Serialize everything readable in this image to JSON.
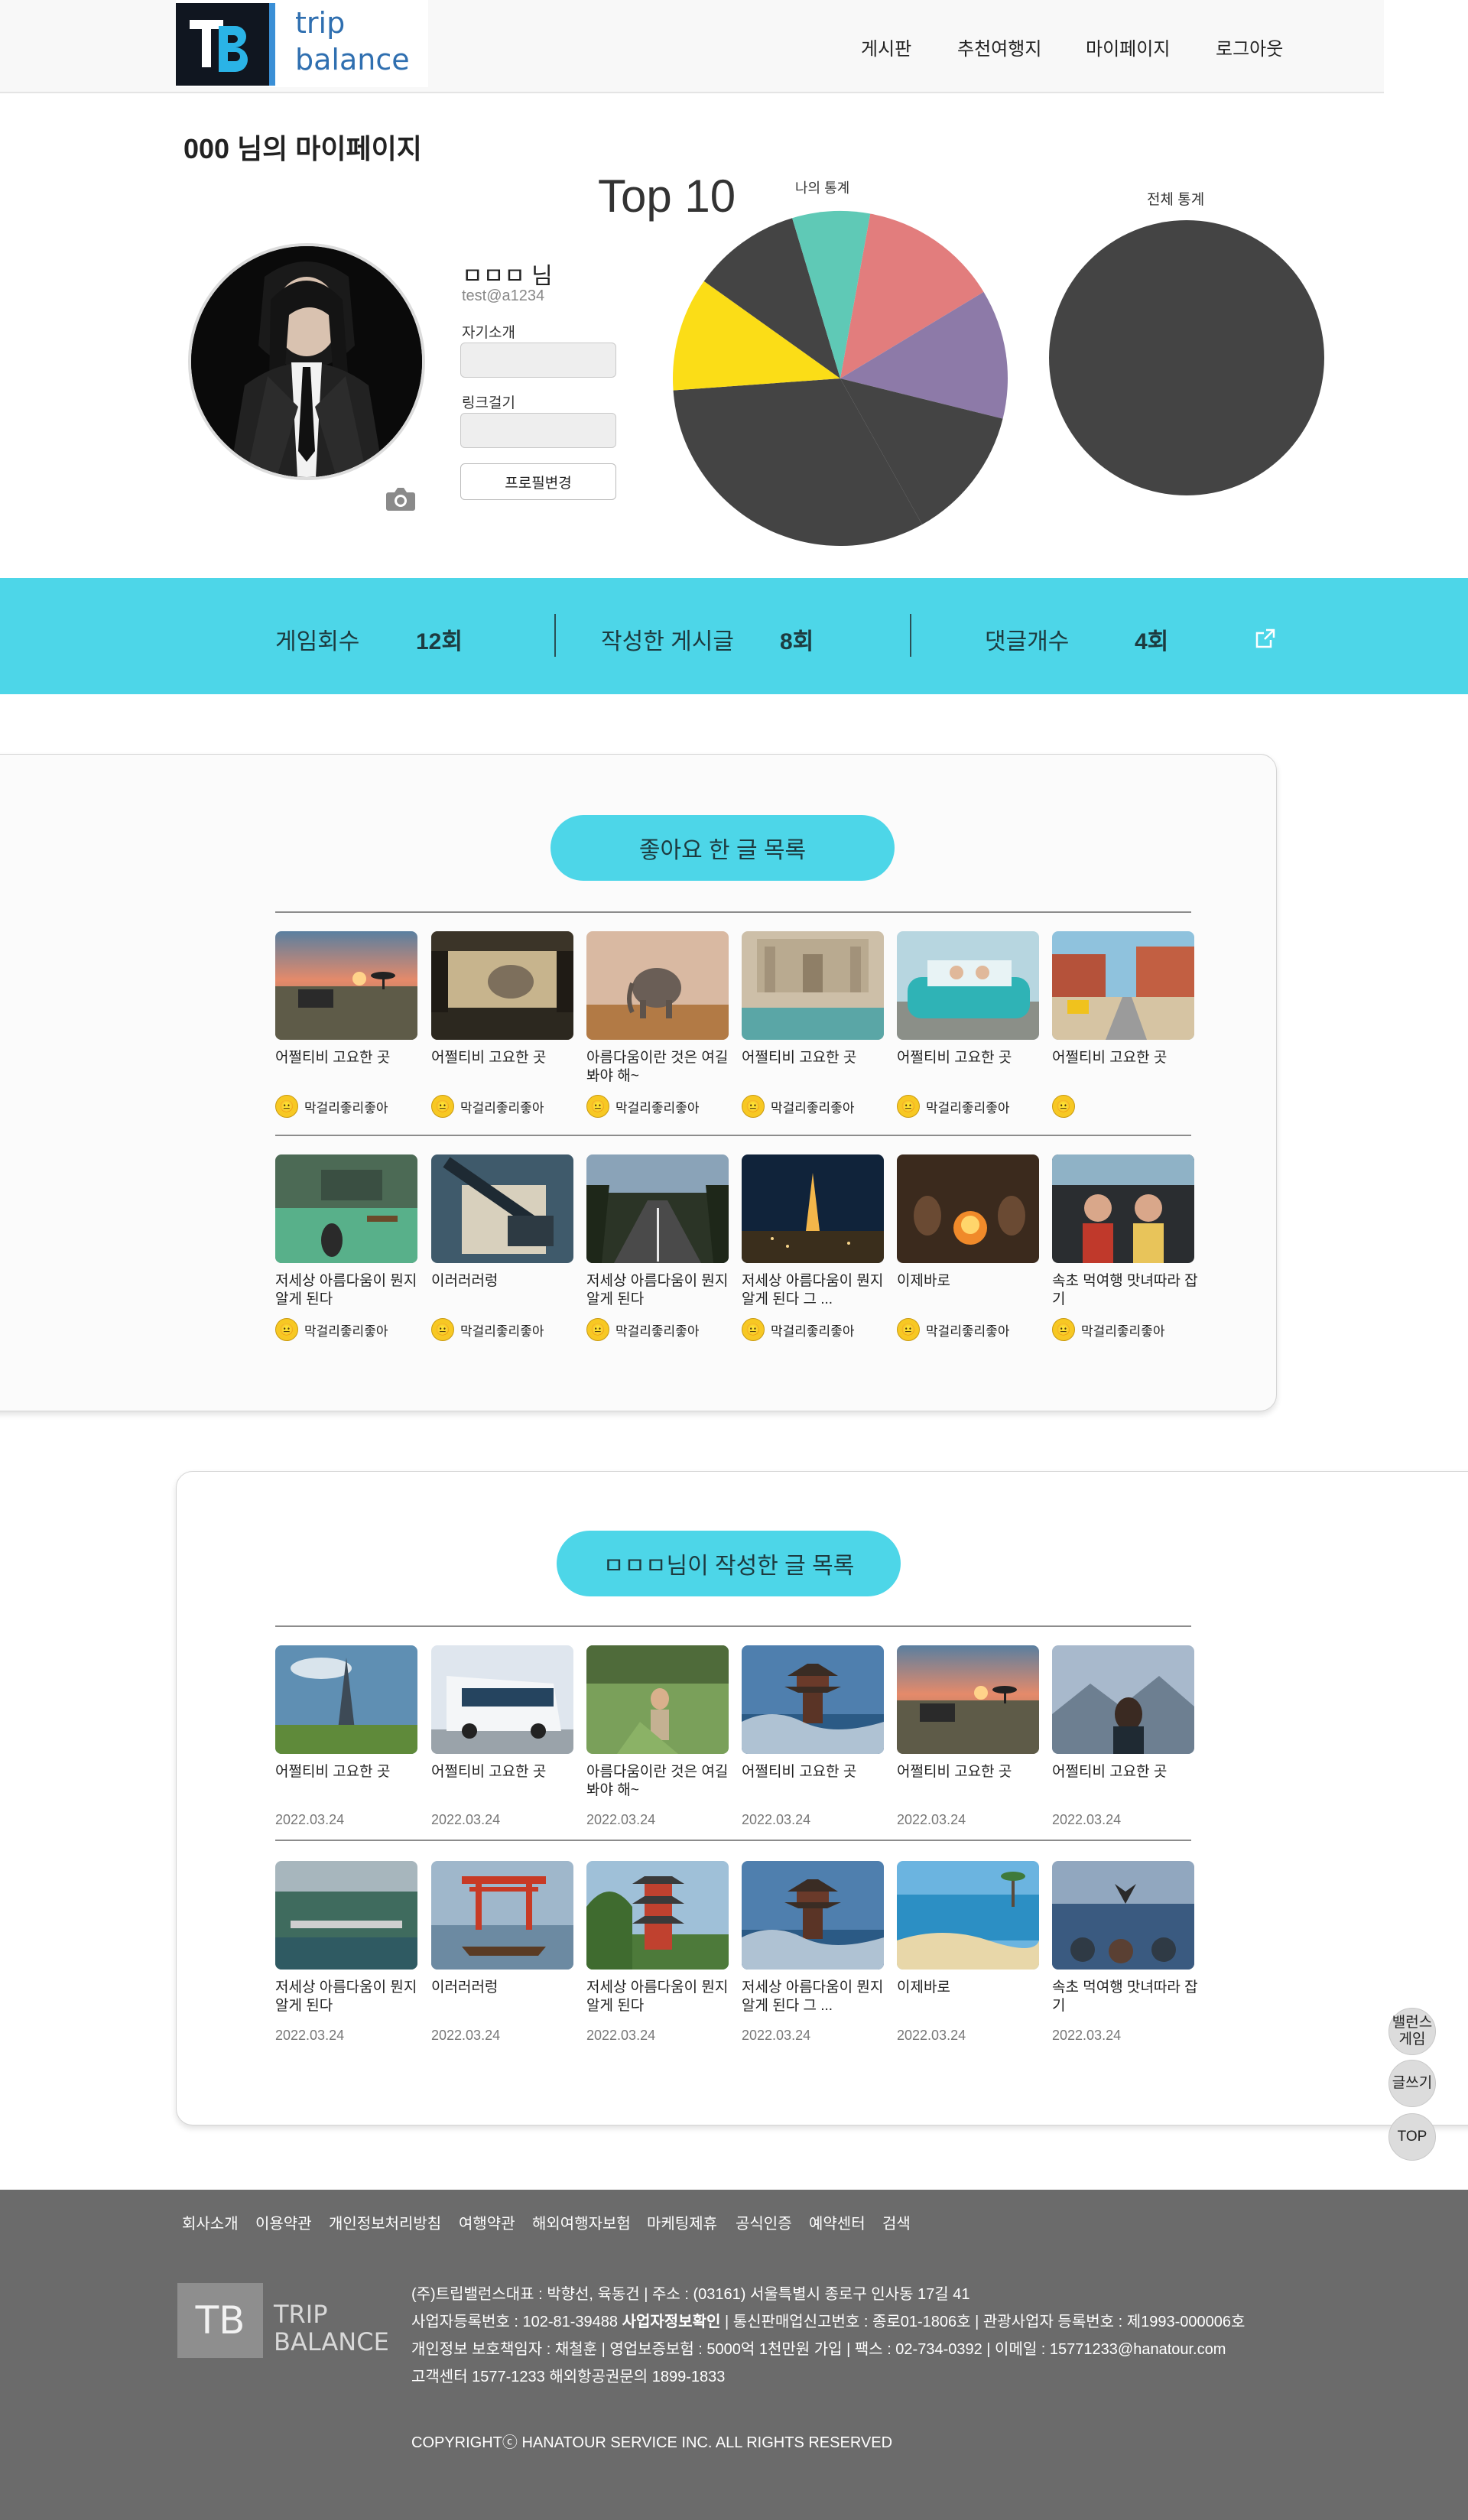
{
  "header": {
    "logo_mark": "TB",
    "logo_line1": "trip",
    "logo_line2": "balance",
    "nav": [
      "게시판",
      "추천여행지",
      "마이페이지",
      "로그아웃"
    ]
  },
  "profile": {
    "page_title": "000 님의 마이페이지",
    "name": "ㅁㅁㅁ 님",
    "email": "test@a1234",
    "intro_label": "자기소개",
    "link_label": "링크걸기",
    "edit_button": "프로필변경"
  },
  "stats_charts": {
    "top_label": "Top 10",
    "my_label": "나의 통계",
    "all_label": "전체 통계"
  },
  "chart_data": [
    {
      "type": "pie",
      "title": "나의 통계",
      "values": [
        13.5,
        12.5,
        13,
        32,
        11,
        10.5,
        7.5
      ],
      "colors": [
        "#e27d7d",
        "#8d7aa8",
        "#444444",
        "#444444",
        "#fbdd17",
        "#444444",
        "#5fc9b6"
      ]
    },
    {
      "type": "pie",
      "title": "전체 통계",
      "values": [
        100
      ],
      "colors": [
        "#444444"
      ]
    }
  ],
  "activity": [
    {
      "label": "게임회수",
      "value": "12회"
    },
    {
      "label": "작성한 게시글",
      "value": "8회"
    },
    {
      "label": "댓글개수",
      "value": "4회"
    }
  ],
  "liked": {
    "heading": "좋아요 한 글 목록",
    "rows": [
      [
        {
          "title": "어쩔티비 고요한 곳",
          "reaction": "막걸리좋리좋아",
          "image": "savanna-sunset"
        },
        {
          "title": "어쩔티비 고요한 곳",
          "reaction": "막걸리좋리좋아",
          "image": "safari-truck"
        },
        {
          "title": "아름다움이란 것은 여길봐야 해~",
          "reaction": "막걸리좋리좋아",
          "image": "elephant"
        },
        {
          "title": "어쩔티비 고요한 곳",
          "reaction": "막걸리좋리좋아",
          "image": "trevi-fountain"
        },
        {
          "title": "어쩔티비 고요한 곳",
          "reaction": "막걸리좋리좋아",
          "image": "vintage-car"
        },
        {
          "title": "어쩔티비 고요한 곳",
          "reaction": "",
          "image": "desert-road"
        }
      ],
      [
        {
          "title": "저세상 아름다움이 뭔지 알게 된다",
          "reaction": "막걸리좋리좋아",
          "image": "lake-boats"
        },
        {
          "title": "이러러러렁",
          "reaction": "막걸리좋리좋아",
          "image": "map-writing"
        },
        {
          "title": "저세상 아름다움이 뭔지 알게 된다",
          "reaction": "막걸리좋리좋아",
          "image": "forest-road"
        },
        {
          "title": "저세상 아름다움이 뭔지 알게 된다 그 ...",
          "reaction": "막걸리좋리좋아",
          "image": "eiffel-night"
        },
        {
          "title": "이제바로",
          "reaction": "막걸리좋리좋아",
          "image": "campfire"
        },
        {
          "title": "속초 먹여행 맛녀따라 잡기",
          "reaction": "막걸리좋리좋아",
          "image": "car-friends"
        }
      ]
    ]
  },
  "written": {
    "heading": "ㅁㅁㅁ님이 작성한 글 목록",
    "rows": [
      [
        {
          "title": "어쩔티비 고요한 곳",
          "date": "2022.03.24",
          "image": "eiffel-day"
        },
        {
          "title": "어쩔티비 고요한 곳",
          "date": "2022.03.24",
          "image": "tour-bus"
        },
        {
          "title": "아름다움이란 것은 여길봐야 해~",
          "date": "2022.03.24",
          "image": "meadow-hiker"
        },
        {
          "title": "어쩔티비 고요한 곳",
          "date": "2022.03.24",
          "image": "pagoda-sea"
        },
        {
          "title": "어쩔티비 고요한 곳",
          "date": "2022.03.24",
          "image": "savanna-sunset"
        },
        {
          "title": "어쩔티비 고요한 곳",
          "date": "2022.03.24",
          "image": "mountain-view"
        }
      ],
      [
        {
          "title": "저세상 아름다움이 뭔지 알게 된다",
          "date": "2022.03.24",
          "image": "dam-lake"
        },
        {
          "title": "이러러러렁",
          "date": "2022.03.24",
          "image": "torii-boat"
        },
        {
          "title": "저세상 아름다움이 뭔지 알게 된다",
          "date": "2022.03.24",
          "image": "red-pagoda"
        },
        {
          "title": "저세상 아름다움이 뭔지 알게 된다 그 ...",
          "date": "2022.03.24",
          "image": "pagoda-sea"
        },
        {
          "title": "이제바로",
          "date": "2022.03.24",
          "image": "beach-cove"
        },
        {
          "title": "속초 먹여행 맛녀따라 잡기",
          "date": "2022.03.24",
          "image": "whale-watch"
        }
      ]
    ]
  },
  "floating": {
    "balance_game": "밸런스 게임",
    "write": "글쓰기",
    "top": "TOP"
  },
  "footer": {
    "links": [
      "회사소개",
      "이용약관",
      "개인정보처리방침",
      "여행약관",
      "해외여행자보험",
      "마케팅제휴",
      "공식인증",
      "예약센터",
      "검색"
    ],
    "logo_mark": "TB",
    "logo_line1": "TRIP",
    "logo_line2": "BALANCE",
    "line1": "(주)트립밸런스대표 : 박향선, 육동건 | 주소 : (03161) 서울특별시 종로구 인사동 17길 41",
    "line2_a": "사업자등록번호 : 102-81-39488 ",
    "line2_b": "사업자정보확인",
    "line2_c": " | 통신판매업신고번호 : 종로01-1806호 | 관광사업자 등록번호 : 제1993-000006호",
    "line3": "개인정보 보호책임자 : 채철훈 | 영업보증보험 : 5000억 1천만원 가입 | 팩스 : 02-734-0392 | 이메일 : 15771233@hanatour.com",
    "line4": "고객센터 1577-1233     해외항공권문의 1899-1833",
    "copyright": "COPYRIGHTⓒ HANATOUR SERVICE INC. ALL RIGHTS RESERVED"
  },
  "colors": {
    "accent": "#4dd6e8",
    "footer_bg": "#6b6b6b",
    "pie_dark": "#444444",
    "pie_pink": "#e27d7d",
    "pie_purple": "#8d7aa8",
    "pie_yellow": "#fbdd17",
    "pie_teal": "#5fc9b6"
  }
}
